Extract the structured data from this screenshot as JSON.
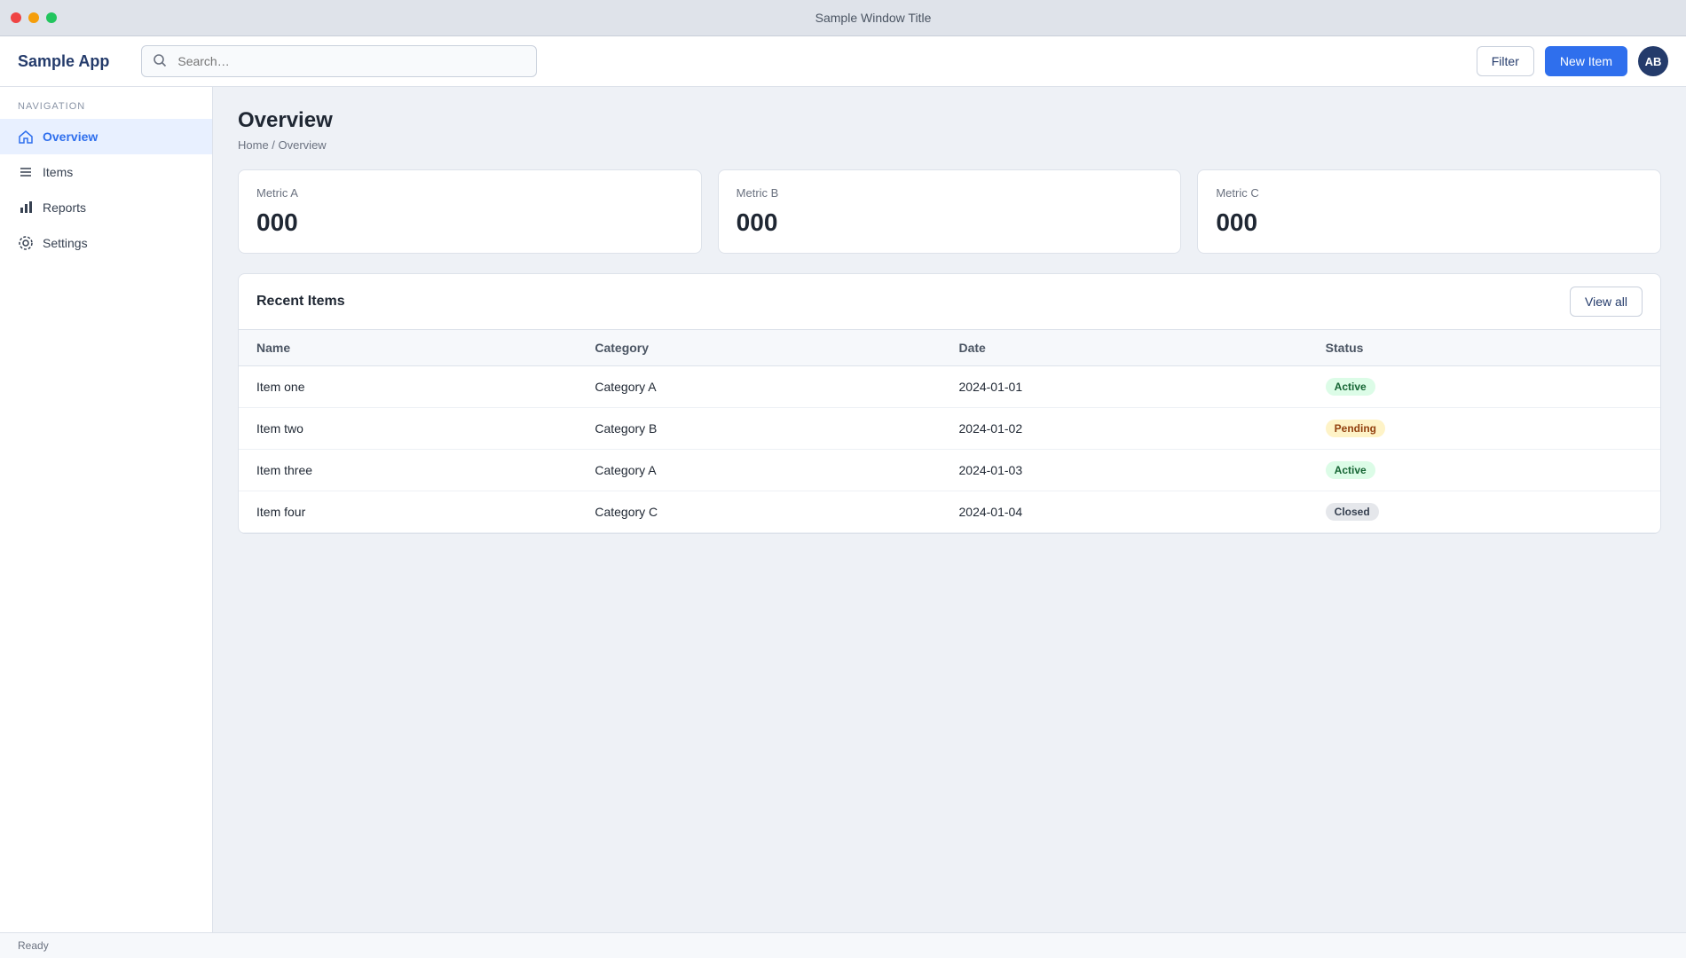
{
  "window": {
    "title": "Sample Window Title"
  },
  "toolbar": {
    "brand": "Sample App",
    "search_placeholder": "Search…",
    "secondary_label": "Filter",
    "primary_label": "New Item",
    "avatar_initials": "AB"
  },
  "sidebar": {
    "heading": "NAVIGATION",
    "items": [
      {
        "label": "Overview",
        "icon": "home-icon"
      },
      {
        "label": "Items",
        "icon": "list-icon"
      },
      {
        "label": "Reports",
        "icon": "chart-icon"
      },
      {
        "label": "Settings",
        "icon": "gear-icon"
      }
    ]
  },
  "main": {
    "title": "Overview",
    "breadcrumb": "Home / Overview",
    "cards": [
      {
        "label": "Metric A",
        "value": "000"
      },
      {
        "label": "Metric B",
        "value": "000"
      },
      {
        "label": "Metric C",
        "value": "000"
      }
    ],
    "table": {
      "title": "Recent Items",
      "action_label": "View all",
      "headers": [
        "Name",
        "Category",
        "Date",
        "Status"
      ],
      "rows": [
        {
          "name": "Item one",
          "category": "Category A",
          "date": "2024-01-01",
          "status": "Active"
        },
        {
          "name": "Item two",
          "category": "Category B",
          "date": "2024-01-02",
          "status": "Pending"
        },
        {
          "name": "Item three",
          "category": "Category A",
          "date": "2024-01-03",
          "status": "Active"
        },
        {
          "name": "Item four",
          "category": "Category C",
          "date": "2024-01-04",
          "status": "Closed"
        }
      ]
    }
  },
  "statusbar": {
    "text": "Ready"
  },
  "colors": {
    "accent": "#2f6fed",
    "active_bg": "#dcfce7",
    "active_fg": "#166534",
    "pending_bg": "#fef3c7",
    "pending_fg": "#92400e",
    "closed_bg": "#e5e7eb",
    "closed_fg": "#374151",
    "dot_red": "#ef4444",
    "dot_yellow": "#f59e0b",
    "dot_green": "#22c55e"
  }
}
